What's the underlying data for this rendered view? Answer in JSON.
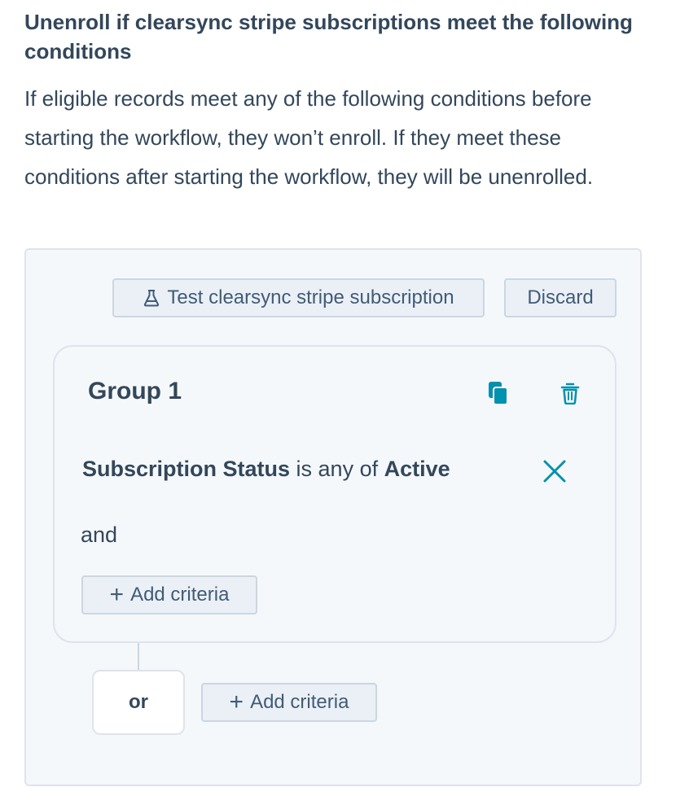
{
  "header": {
    "title": "Unenroll if clearsync stripe subscriptions meet the following conditions",
    "description": "If eligible records meet any of the following conditions before starting the workflow, they won’t enroll. If they meet these conditions after starting the workflow, they will be unenrolled."
  },
  "toolbar": {
    "test_label": "Test clearsync stripe subscription",
    "discard_label": "Discard"
  },
  "group": {
    "title": "Group 1",
    "criterion": {
      "property": "Subscription Status",
      "operator": " is any of ",
      "value": "Active"
    },
    "and_label": "and",
    "add_criteria_label": "Add criteria"
  },
  "or_section": {
    "or_label": "or",
    "add_criteria_label": "Add criteria"
  },
  "icons": {
    "test": "flask-icon",
    "copy": "copy-icon",
    "delete": "trash-icon",
    "remove": "close-icon",
    "add": "plus-icon"
  },
  "colors": {
    "text": "#33475b",
    "accent": "#0091ae",
    "panel_bg": "#f5f8fa",
    "button_bg": "#eaf0f6",
    "border": "#cbd6e2"
  }
}
